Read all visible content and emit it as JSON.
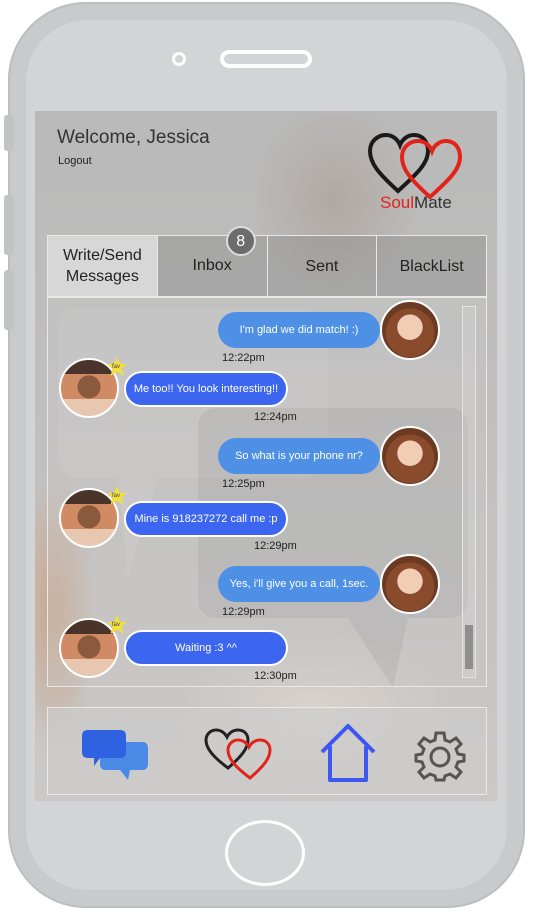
{
  "header": {
    "welcome": "Welcome, Jessica",
    "logout": "Logout",
    "logo_soul": "Soul",
    "logo_mate": "Mate"
  },
  "tabs": [
    {
      "label_line1": "Write/Send",
      "label_line2": "Messages",
      "active": true
    },
    {
      "label_line1": "Inbox",
      "badge": "8"
    },
    {
      "label_line1": "Sent"
    },
    {
      "label_line1": "BlackList"
    }
  ],
  "messages": [
    {
      "direction": "out",
      "text": "I'm glad we did match! :)",
      "time": "12:22pm"
    },
    {
      "direction": "in",
      "text": "Me too!! You look interesting!!",
      "time": "12:24pm",
      "fav": "fav"
    },
    {
      "direction": "out",
      "text": "So what is your phone nr?",
      "time": "12:25pm"
    },
    {
      "direction": "in",
      "text": "Mine is 918237272 call me :p",
      "time": "12:29pm",
      "fav": "fav"
    },
    {
      "direction": "out",
      "text": "Yes, i'll give you a call, 1sec.",
      "time": "12:29pm"
    },
    {
      "direction": "in",
      "text": "Waiting :3 ^^",
      "time": "12:30pm",
      "fav": "fav"
    }
  ],
  "bottom_nav": [
    {
      "icon": "chat-bubbles-icon"
    },
    {
      "icon": "hearts-icon"
    },
    {
      "icon": "home-icon"
    },
    {
      "icon": "gear-icon"
    }
  ],
  "colors": {
    "outgoing_bubble": "#4d90e6",
    "incoming_bubble": "#3d66f0",
    "brand_red": "#e2231a",
    "home_icon": "#3d57f0"
  }
}
